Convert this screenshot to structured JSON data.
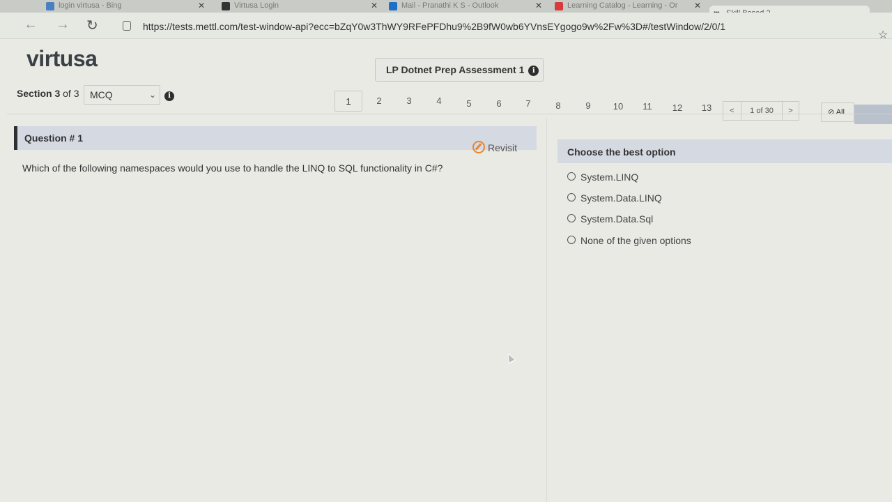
{
  "browser": {
    "tabs": [
      {
        "label": "login virtusa - Bing",
        "color": "#4a7fc1"
      },
      {
        "label": "Virtusa Login",
        "color": "#333333"
      },
      {
        "label": "Mail - Pranathi K S - Outlook",
        "color": "#1e6fc7"
      },
      {
        "label": "Learning Catalog - Learning - Or",
        "color": "#d83b3b"
      },
      {
        "label": "Skill Based 2",
        "favicon": "m",
        "active": true
      }
    ],
    "url": "https://tests.mettl.com/test-window-api?ecc=bZqY0w3ThWY9RFePFDhu9%2B9fW0wb6YVnsEYgogo9w%2Fw%3D#/testWindow/2/0/1"
  },
  "header": {
    "logo": "virtusa",
    "assessment_title": "LP Dotnet Prep Assessment 1",
    "info_glyph": "i"
  },
  "section": {
    "label_bold": "Section 3",
    "label_rest": " of 3",
    "selected": "MCQ"
  },
  "pagination": {
    "pages": [
      "1",
      "2",
      "3",
      "4",
      "5",
      "6",
      "7",
      "8",
      "9",
      "10",
      "11",
      "12",
      "13"
    ],
    "current": "1",
    "prev": "<",
    "next": ">",
    "count_text": "1 of 30",
    "all_label": "All"
  },
  "question": {
    "title": "Question # 1",
    "revisit_label": "Revisit",
    "text": "Which of the following namespaces would you use to handle the LINQ to SQL functionality in C#?"
  },
  "options": {
    "title": "Choose the best option",
    "items": [
      "System.LINQ",
      "System.Data.LINQ",
      "System.Data.Sql",
      "None of the given options"
    ]
  }
}
